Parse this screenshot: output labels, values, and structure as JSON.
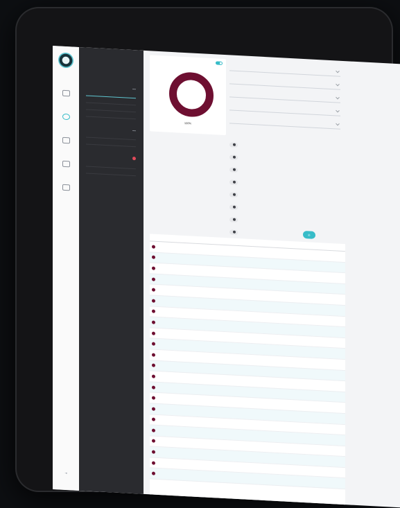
{
  "colors": {
    "accent": "#37bcc8",
    "donut": "#6e0f31",
    "sidebar_bg": "#2a2b2f",
    "alert": "#e24a5b"
  },
  "rail": {
    "items": [
      "",
      "",
      "",
      "",
      ""
    ]
  },
  "panel": {
    "sections": [
      {
        "title": "",
        "items": [
          "",
          "",
          "",
          ""
        ]
      },
      {
        "title": "",
        "items": [
          "",
          ""
        ]
      },
      {
        "title": "",
        "items": [
          "",
          ""
        ]
      }
    ]
  },
  "donut_card": {
    "title": "",
    "percent": "100%"
  },
  "filters": {
    "date_label": "",
    "date_value": "",
    "fields": [
      "",
      "",
      "",
      "",
      ""
    ],
    "chips": [
      "",
      "",
      "",
      "",
      "",
      "",
      "",
      ""
    ],
    "bottom_fields": [
      "",
      ""
    ]
  },
  "export_label": "",
  "table": {
    "headers": [
      "",
      "",
      "",
      ""
    ],
    "rows": [
      {
        "a": "",
        "b": "",
        "c": "",
        "d": ""
      },
      {
        "a": "",
        "b": "",
        "c": "",
        "d": ""
      },
      {
        "a": "",
        "b": "",
        "c": "",
        "d": ""
      },
      {
        "a": "",
        "b": "",
        "c": "",
        "d": ""
      },
      {
        "a": "",
        "b": "",
        "c": "",
        "d": ""
      },
      {
        "a": "",
        "b": "",
        "c": "",
        "d": ""
      },
      {
        "a": "",
        "b": "",
        "c": "",
        "d": ""
      },
      {
        "a": "",
        "b": "",
        "c": "",
        "d": ""
      },
      {
        "a": "",
        "b": "",
        "c": "",
        "d": ""
      },
      {
        "a": "",
        "b": "",
        "c": "",
        "d": ""
      },
      {
        "a": "",
        "b": "",
        "c": "",
        "d": ""
      },
      {
        "a": "",
        "b": "",
        "c": "",
        "d": ""
      },
      {
        "a": "",
        "b": "",
        "c": "",
        "d": ""
      },
      {
        "a": "",
        "b": "",
        "c": "",
        "d": ""
      },
      {
        "a": "",
        "b": "",
        "c": "",
        "d": ""
      },
      {
        "a": "",
        "b": "",
        "c": "",
        "d": ""
      },
      {
        "a": "",
        "b": "",
        "c": "",
        "d": ""
      },
      {
        "a": "",
        "b": "",
        "c": "",
        "d": ""
      },
      {
        "a": "",
        "b": "",
        "c": "",
        "d": ""
      },
      {
        "a": "",
        "b": "",
        "c": "",
        "d": ""
      },
      {
        "a": "",
        "b": "",
        "c": "",
        "d": ""
      },
      {
        "a": "",
        "b": "",
        "c": "",
        "d": ""
      }
    ]
  }
}
